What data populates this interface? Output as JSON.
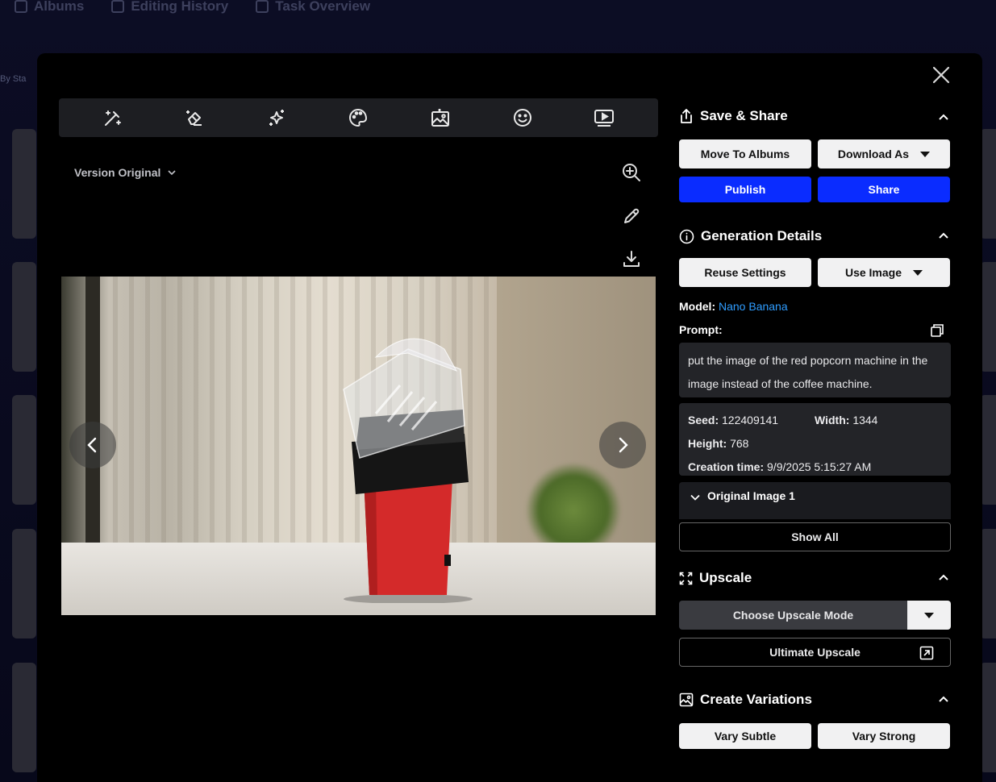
{
  "background": {
    "tabs": [
      "Albums",
      "Editing History",
      "Task Overview"
    ],
    "side_label": "By Sta"
  },
  "toolbar": {
    "tools": [
      "magic-wand-icon",
      "eraser-icon",
      "sparkles-icon",
      "palette-icon",
      "image-edit-icon",
      "smiley-icon",
      "video-play-icon"
    ]
  },
  "viewer": {
    "version_label": "Version Original"
  },
  "save_share": {
    "title": "Save & Share",
    "move_to_albums": "Move To Albums",
    "download_as": "Download As",
    "publish": "Publish",
    "share": "Share"
  },
  "generation": {
    "title": "Generation Details",
    "reuse_settings": "Reuse Settings",
    "use_image": "Use Image",
    "model_label": "Model:",
    "model_value": "Nano Banana",
    "prompt_label": "Prompt:",
    "prompt_text": "put the image of the red popcorn machine in the image instead of the coffee machine.",
    "seed_label": "Seed:",
    "seed_value": "122409141",
    "width_label": "Width:",
    "width_value": "1344",
    "height_label": "Height:",
    "height_value": "768",
    "creation_label": "Creation time:",
    "creation_value": "9/9/2025 5:15:27 AM",
    "original_image": "Original Image 1",
    "show_all": "Show All"
  },
  "upscale": {
    "title": "Upscale",
    "choose_mode": "Choose Upscale Mode",
    "ultimate": "Ultimate Upscale"
  },
  "variations": {
    "title": "Create Variations",
    "vary_subtle": "Vary Subtle",
    "vary_strong": "Vary Strong"
  },
  "colors": {
    "accent_blue": "#0a2cff",
    "link_blue": "#2f9dff",
    "modal_bg": "#000000",
    "panel_box": "#232428"
  }
}
